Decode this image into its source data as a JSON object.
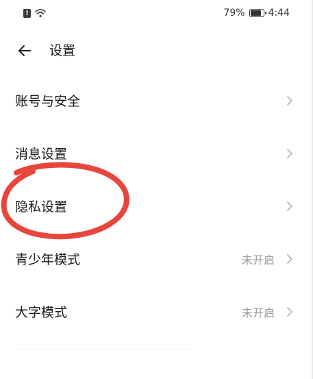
{
  "status_bar": {
    "battery_percent": "79%",
    "battery_level": 0.79,
    "time": "4:44",
    "sim_alert_icon": "sim-alert-icon",
    "wifi_icon": "wifi-icon",
    "battery_icon": "battery-icon"
  },
  "header": {
    "back_icon": "arrow-left-icon",
    "title": "设置"
  },
  "settings": {
    "items": [
      {
        "label": "账号与安全",
        "value": ""
      },
      {
        "label": "消息设置",
        "value": ""
      },
      {
        "label": "隐私设置",
        "value": ""
      },
      {
        "label": "青少年模式",
        "value": "未开启"
      },
      {
        "label": "大字模式",
        "value": "未开启"
      }
    ]
  },
  "colors": {
    "annotation": "#e8453c",
    "secondary_text": "#9a9a9a",
    "chevron": "#b5b5b5"
  }
}
